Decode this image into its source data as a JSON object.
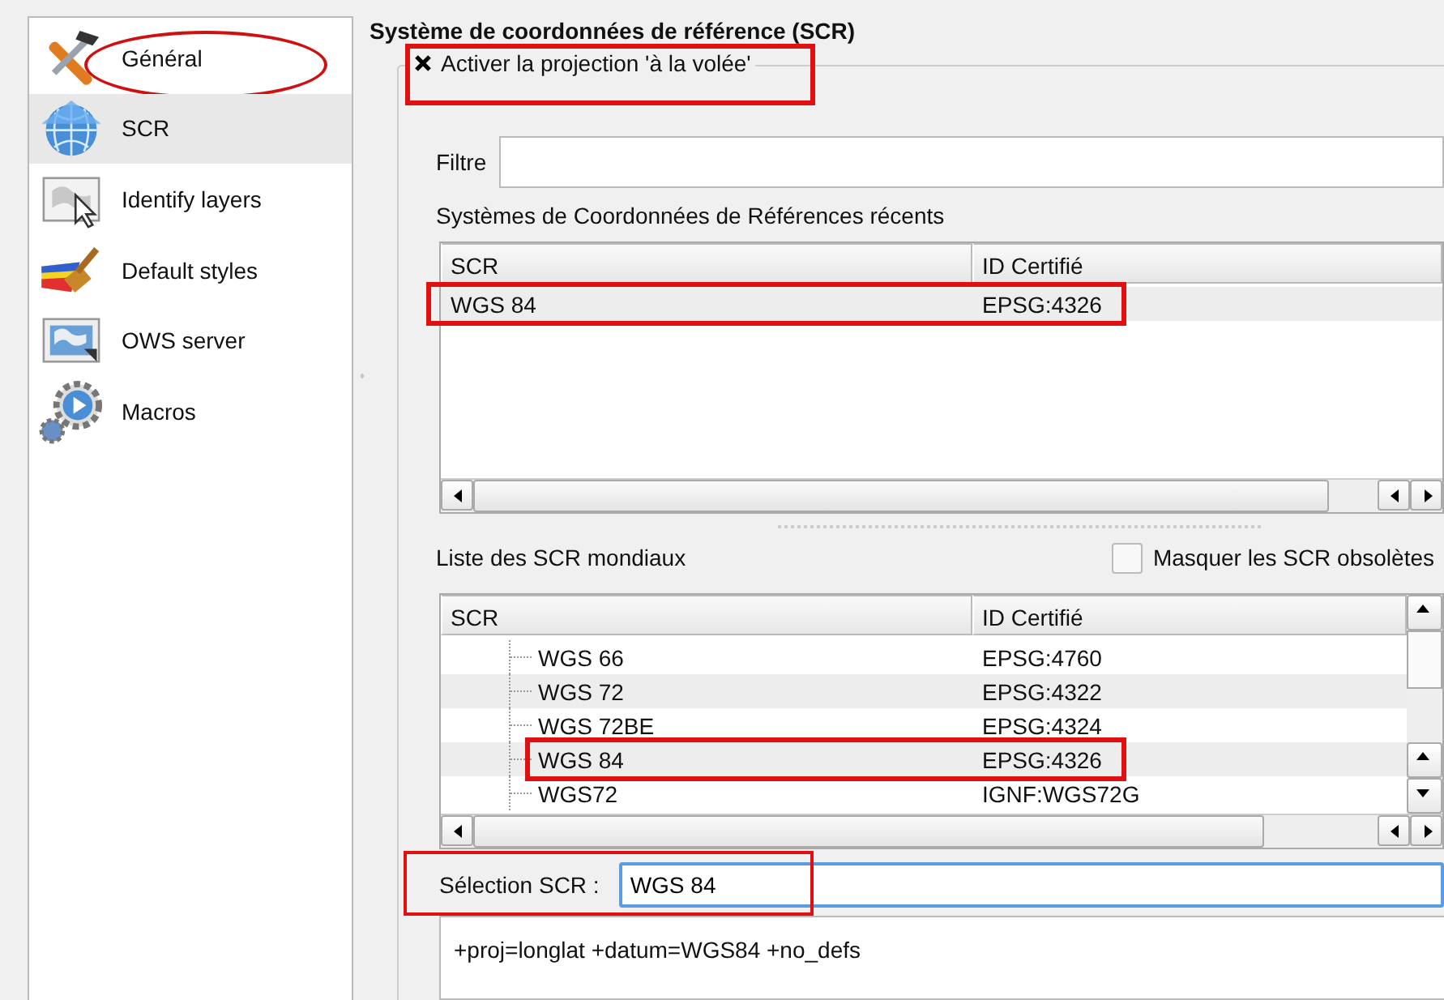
{
  "sidebar": {
    "items": [
      {
        "label": "Général",
        "kind": "tools",
        "selected": false,
        "circled": true
      },
      {
        "label": "SCR",
        "kind": "globe",
        "selected": true,
        "circled": false
      },
      {
        "label": "Identify layers",
        "kind": "map-cursor",
        "selected": false,
        "circled": false
      },
      {
        "label": "Default styles",
        "kind": "brush",
        "selected": false,
        "circled": false
      },
      {
        "label": "OWS server",
        "kind": "map",
        "selected": false,
        "circled": false
      },
      {
        "label": "Macros",
        "kind": "gear",
        "selected": false,
        "circled": false
      }
    ]
  },
  "section_title": "Système de coordonnées de référence (SCR)",
  "projection_group": {
    "label": "Activer la projection 'à la volée'",
    "checked": true,
    "highlighted": true
  },
  "filter": {
    "label": "Filtre"
  },
  "recent": {
    "label": "Systèmes de Coordonnées de Références récents",
    "columns": [
      "SCR",
      "ID Certifié"
    ],
    "rows": [
      {
        "cells": [
          "WGS 84",
          "EPSG:4326"
        ],
        "selected": true,
        "highlighted": true
      }
    ]
  },
  "world": {
    "label": "Liste des SCR mondiaux",
    "hide_obsolete": {
      "label": "Masquer les SCR obsolètes",
      "checked": false
    },
    "columns": [
      "SCR",
      "ID Certifié"
    ],
    "rows": [
      {
        "cells": [
          "WGS 66",
          "EPSG:4760"
        ],
        "highlighted": false
      },
      {
        "cells": [
          "WGS 72",
          "EPSG:4322"
        ],
        "highlighted": false
      },
      {
        "cells": [
          "WGS 72BE",
          "EPSG:4324"
        ],
        "highlighted": false
      },
      {
        "cells": [
          "WGS 84",
          "EPSG:4326"
        ],
        "highlighted": true
      },
      {
        "cells": [
          "WGS72",
          "IGNF:WGS72G"
        ],
        "highlighted": false
      }
    ]
  },
  "selection": {
    "label": "Sélection SCR :",
    "value": "WGS 84",
    "highlighted": true
  },
  "proj_string": "+proj=longlat +datum=WGS84 +no_defs"
}
